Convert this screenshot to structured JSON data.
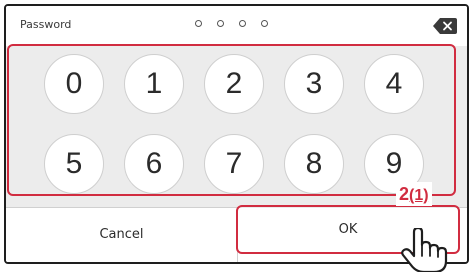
{
  "header": {
    "password_label": "Password",
    "pin_dots": 4,
    "backspace_icon": "backspace-icon"
  },
  "keypad": {
    "keys": [
      "0",
      "1",
      "2",
      "3",
      "4",
      "5",
      "6",
      "7",
      "8",
      "9"
    ]
  },
  "footer": {
    "cancel_label": "Cancel",
    "ok_label": "OK"
  },
  "annotation": {
    "step_number": "2",
    "step_sub": "(1)",
    "pointer_icon": "hand-pointer-icon"
  },
  "colors": {
    "highlight": "#d12c40",
    "key_bg": "#ffffff",
    "panel_bg": "#ececec"
  }
}
